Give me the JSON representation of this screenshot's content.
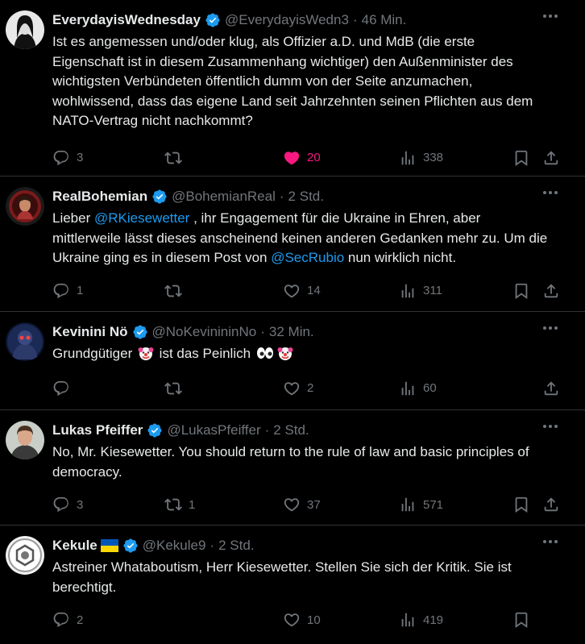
{
  "tweets": [
    {
      "name": "EverydayisWednesday",
      "handle": "@EverydayisWedn3",
      "time": "46 Min.",
      "text_parts": [
        "Ist es angemessen und/oder klug, als Offizier a.D. und MdB (die erste Eigenschaft ist in diesem Zusammenhang wichtiger) den Außenminister des wichtigsten Verbündeten öffentlich dumm von der Seite anzumachen, wohlwissend, dass das eigene Land seit Jahrzehnten seinen Pflichten aus dem NATO-Vertrag nicht nachkommt?"
      ],
      "replies": "3",
      "retweets": "",
      "likes": "20",
      "views": "338",
      "liked": true
    },
    {
      "name": "RealBohemian",
      "handle": "@BohemianReal",
      "time": "2 Std.",
      "text_parts": [
        "Lieber ",
        "@RKiesewetter",
        " , ihr Engagement für die Ukraine in Ehren, aber mittlerweile lässt dieses anscheinend keinen anderen Gedanken mehr zu. Um die Ukraine ging es in diesem Post von ",
        "@SecRubio",
        " nun wirklich nicht."
      ],
      "replies": "1",
      "retweets": "",
      "likes": "14",
      "views": "311",
      "liked": false
    },
    {
      "name": "Kevinini Nö",
      "handle": "@NoKevinininNo",
      "time": "32 Min.",
      "text_parts": [
        "Grundgütiger ",
        " ist das Peinlich "
      ],
      "replies": "",
      "retweets": "",
      "likes": "2",
      "views": "60",
      "liked": false
    },
    {
      "name": "Lukas Pfeiffer",
      "handle": "@LukasPfeiffer",
      "time": "2 Std.",
      "text_parts": [
        "No, Mr. Kiesewetter. You should return to the rule of law and basic principles of democracy."
      ],
      "replies": "3",
      "retweets": "1",
      "likes": "37",
      "views": "571",
      "liked": false
    },
    {
      "name": "Kekule",
      "handle": "@Kekule9",
      "time": "2 Std.",
      "text_parts": [
        "Astreiner Whataboutism, Herr Kiesewetter. Stellen Sie sich der Kritik. Sie ist berechtigt."
      ],
      "replies": "2",
      "retweets": "",
      "likes": "10",
      "views": "419",
      "liked": false
    }
  ],
  "colors": {
    "accent": "#1d9bf0",
    "like": "#f91880",
    "muted": "#71767b",
    "border": "#2f3336"
  },
  "icons": [
    "reply-icon",
    "retweet-icon",
    "like-icon",
    "views-icon",
    "bookmark-icon",
    "share-icon",
    "verified-icon",
    "more-icon",
    "clown-emoji",
    "eyes-emoji",
    "ukraine-flag"
  ]
}
